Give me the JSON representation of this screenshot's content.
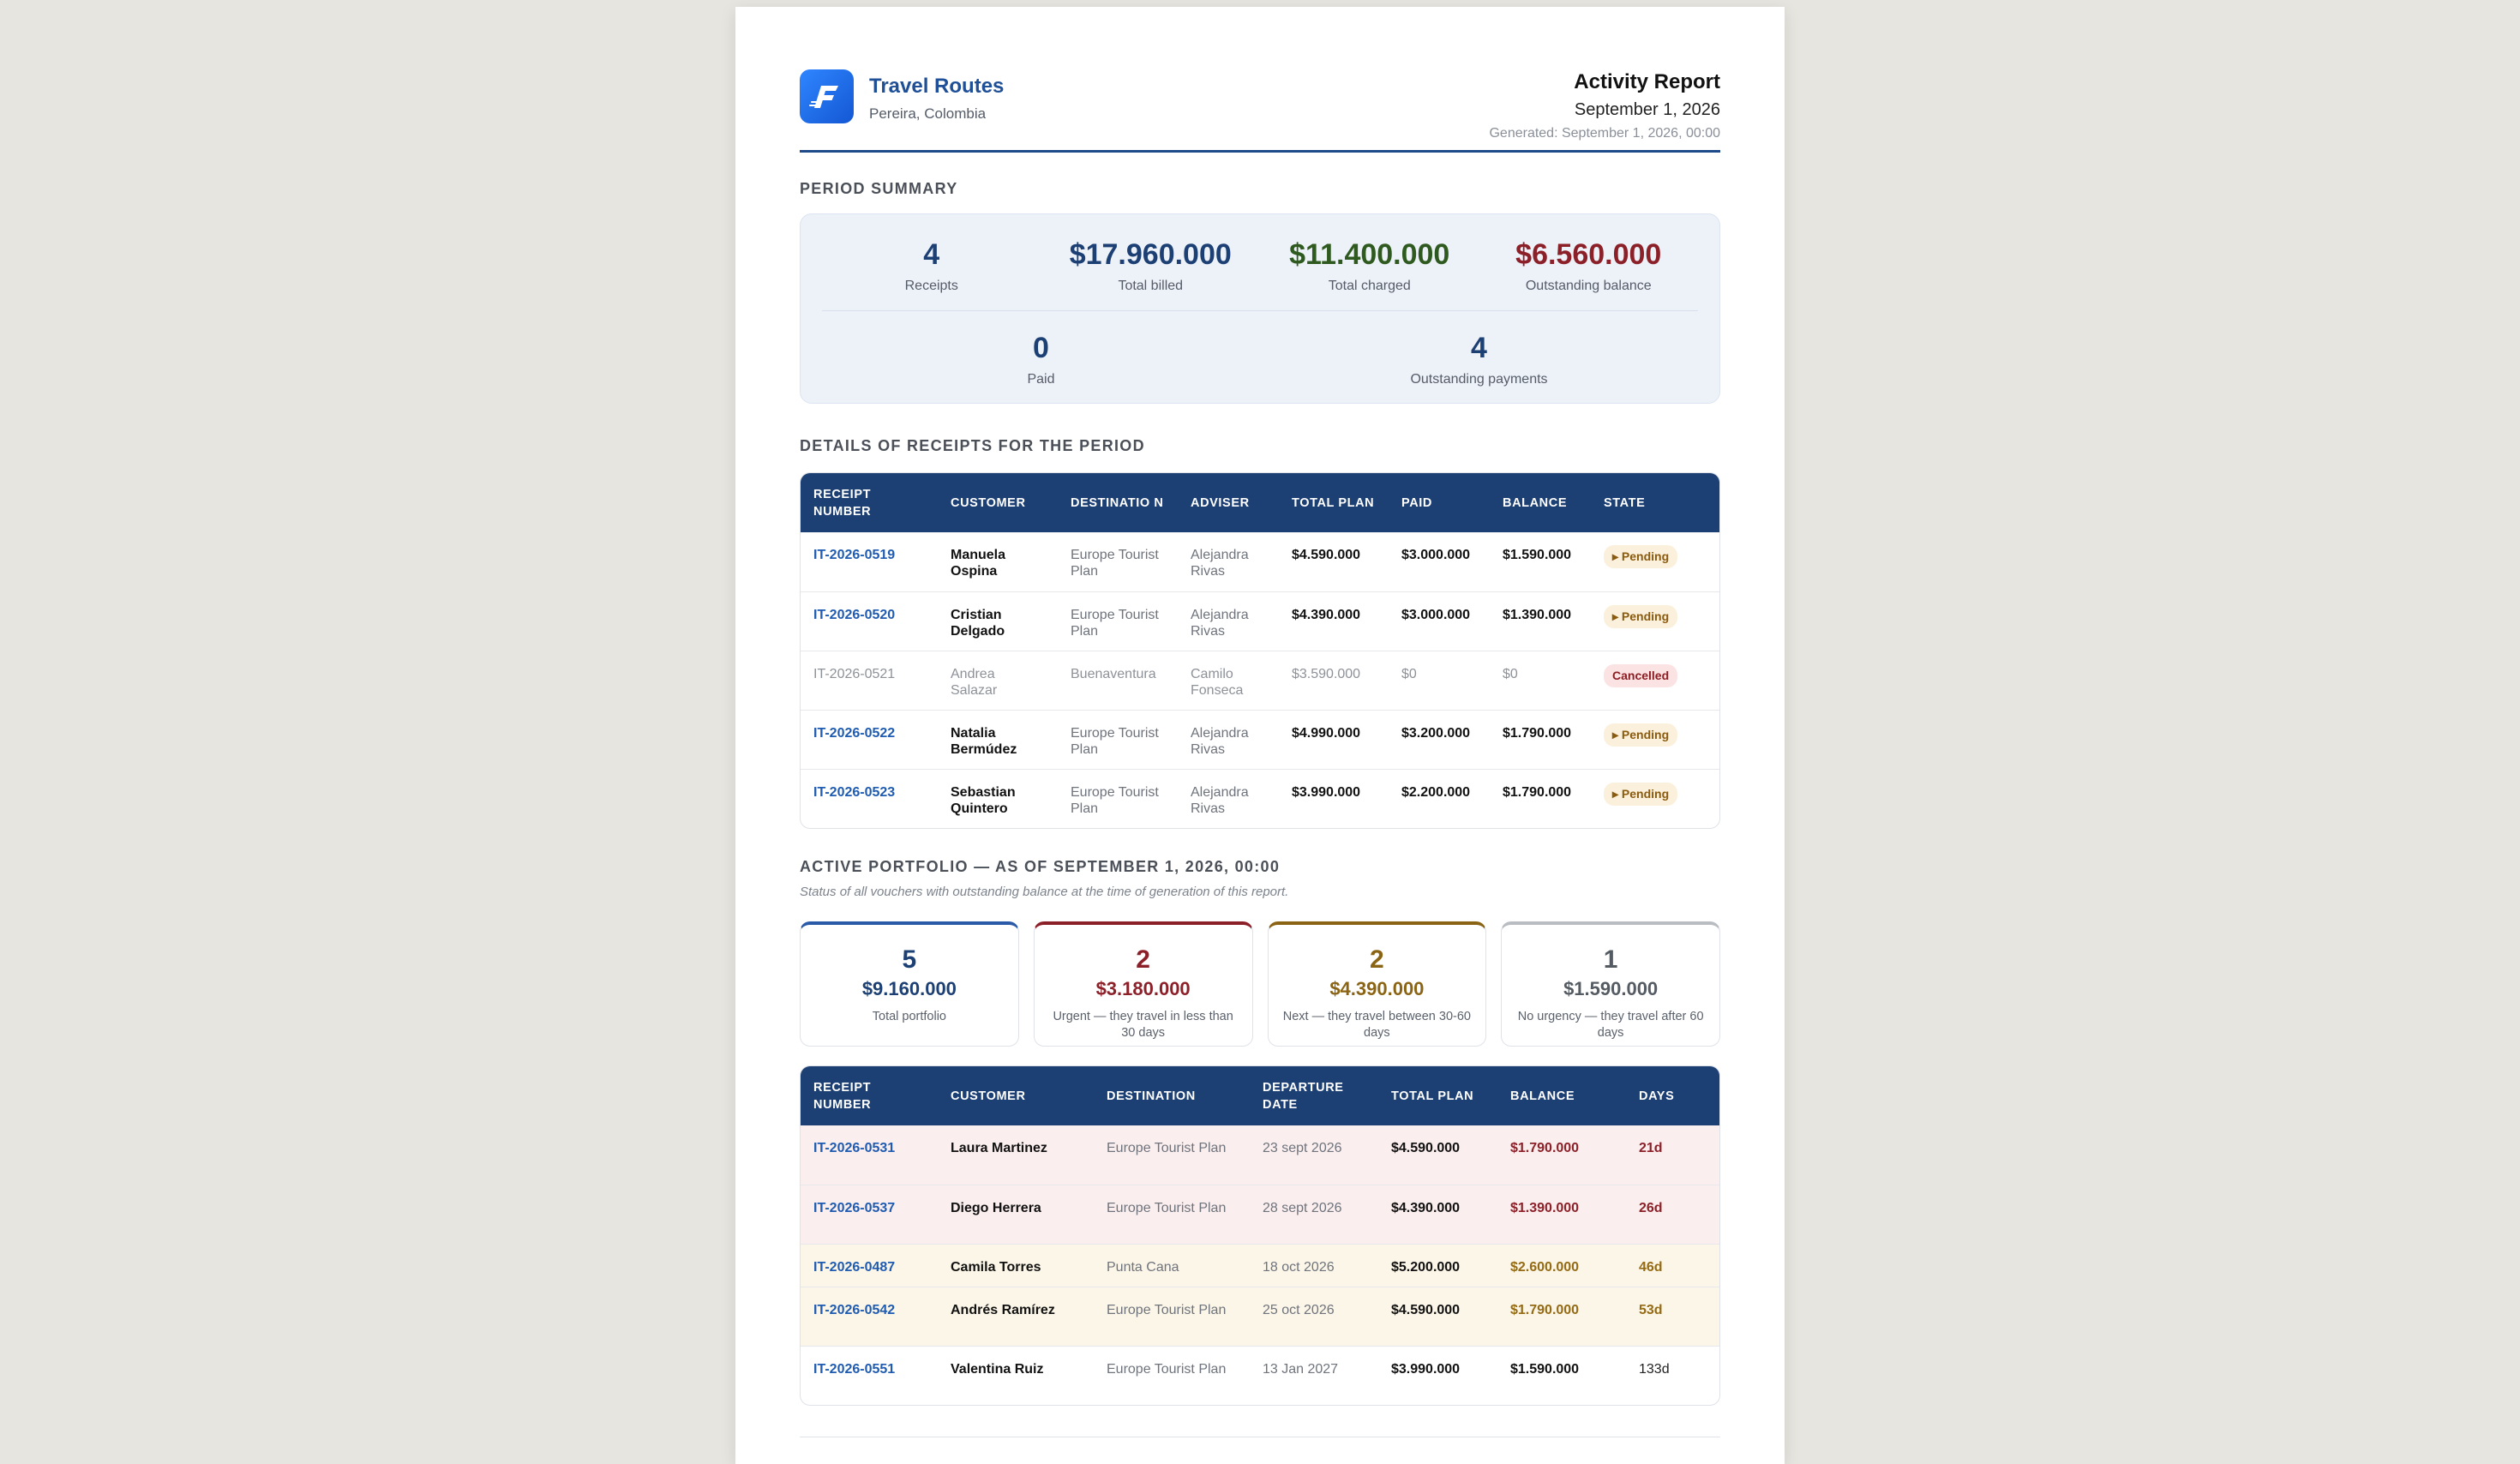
{
  "brand": {
    "name": "Travel Routes",
    "city": "Pereira, Colombia",
    "logo_letter": "F"
  },
  "report": {
    "title": "Activity Report",
    "date": "September 1, 2026",
    "generated": "Generated: September 1, 2026, 00:00"
  },
  "summary": {
    "title": "PERIOD SUMMARY",
    "stats": [
      {
        "value": "4",
        "label": "Receipts",
        "color": "#1c3f74"
      },
      {
        "value": "$17.960.000",
        "label": "Total billed",
        "color": "#1c3f74"
      },
      {
        "value": "$11.400.000",
        "label": "Total charged",
        "color": "#2f5a1f"
      },
      {
        "value": "$6.560.000",
        "label": "Outstanding balance",
        "color": "#8c2029"
      }
    ],
    "stats2": [
      {
        "value": "0",
        "label": "Paid",
        "color": "#1c3f74"
      },
      {
        "value": "4",
        "label": "Outstanding payments",
        "color": "#1c3f74"
      }
    ]
  },
  "receipts": {
    "title": "DETAILS OF RECEIPTS FOR THE PERIOD",
    "headers": [
      "RECEIPT NUMBER",
      "CUSTOMER",
      "DESTINATIO N",
      "ADVISER",
      "TOTAL PLAN",
      "PAID",
      "BALANCE",
      "STATE"
    ],
    "rows": [
      {
        "number": "IT-2026-0519",
        "customer": "Manuela Ospina",
        "destination": "Europe Tourist Plan",
        "adviser": "Alejandra Rivas",
        "total": "$4.590.000",
        "paid": "$3.000.000",
        "balance": "$1.590.000",
        "state": "▸ Pending",
        "status": "pending"
      },
      {
        "number": "IT-2026-0520",
        "customer": "Cristian Delgado",
        "destination": "Europe Tourist Plan",
        "adviser": "Alejandra Rivas",
        "total": "$4.390.000",
        "paid": "$3.000.000",
        "balance": "$1.390.000",
        "state": "▸ Pending",
        "status": "pending"
      },
      {
        "number": "IT-2026-0521",
        "customer": "Andrea Salazar",
        "destination": "Buenaventura",
        "adviser": "Camilo Fonseca",
        "total": "$3.590.000",
        "paid": "$0",
        "balance": "$0",
        "state": "Cancelled",
        "status": "cancelled"
      },
      {
        "number": "IT-2026-0522",
        "customer": "Natalia Bermúdez",
        "destination": "Europe Tourist Plan",
        "adviser": "Alejandra Rivas",
        "total": "$4.990.000",
        "paid": "$3.200.000",
        "balance": "$1.790.000",
        "state": "▸ Pending",
        "status": "pending"
      },
      {
        "number": "IT-2026-0523",
        "customer": "Sebastian Quintero",
        "destination": "Europe Tourist Plan",
        "adviser": "Alejandra Rivas",
        "total": "$3.990.000",
        "paid": "$2.200.000",
        "balance": "$1.790.000",
        "state": "▸ Pending",
        "status": "pending"
      }
    ]
  },
  "portfolio": {
    "title": "ACTIVE PORTFOLIO — AS OF SEPTEMBER 1, 2026, 00:00",
    "subtitle": "Status of all vouchers with outstanding balance at the time of generation of this report.",
    "cards": [
      {
        "count": "5",
        "amount": "$9.160.000",
        "label": "Total portfolio",
        "color": "#1c3f74",
        "border": "#2a5aa8"
      },
      {
        "count": "2",
        "amount": "$3.180.000",
        "label": "Urgent — they travel in less than 30 days",
        "color": "#8c2029",
        "border": "#8c2029"
      },
      {
        "count": "2",
        "amount": "$4.390.000",
        "label": "Next — they travel between 30-60 days",
        "color": "#8a6414",
        "border": "#8a6414"
      },
      {
        "count": "1",
        "amount": "$1.590.000",
        "label": "No urgency — they travel after 60 days",
        "color": "#555b63",
        "border": "#b9bcc1"
      }
    ],
    "headers": [
      "RECEIPT NUMBER",
      "CUSTOMER",
      "DESTINATION",
      "DEPARTURE DATE",
      "TOTAL PLAN",
      "BALANCE",
      "DAYS"
    ],
    "rows": [
      {
        "number": "IT-2026-0531",
        "customer": "Laura Martinez",
        "destination": "Europe Tourist Plan",
        "departure": "23 sept 2026",
        "total": "$4.590.000",
        "balance": "$1.790.000",
        "days": "21d",
        "level": "urgent"
      },
      {
        "number": "IT-2026-0537",
        "customer": "Diego Herrera",
        "destination": "Europe Tourist Plan",
        "departure": "28 sept 2026",
        "total": "$4.390.000",
        "balance": "$1.390.000",
        "days": "26d",
        "level": "urgent"
      },
      {
        "number": "IT-2026-0487",
        "customer": "Camila Torres",
        "destination": "Punta Cana",
        "departure": "18 oct 2026",
        "total": "$5.200.000",
        "balance": "$2.600.000",
        "days": "46d",
        "level": "next"
      },
      {
        "number": "IT-2026-0542",
        "customer": "Andrés Ramírez",
        "destination": "Europe Tourist Plan",
        "departure": "25 oct 2026",
        "total": "$4.590.000",
        "balance": "$1.790.000",
        "days": "53d",
        "level": "next"
      },
      {
        "number": "IT-2026-0551",
        "customer": "Valentina Ruiz",
        "destination": "Europe Tourist Plan",
        "departure": "13 Jan 2027",
        "total": "$3.990.000",
        "balance": "$1.590.000",
        "days": "133d",
        "level": "none"
      }
    ]
  }
}
